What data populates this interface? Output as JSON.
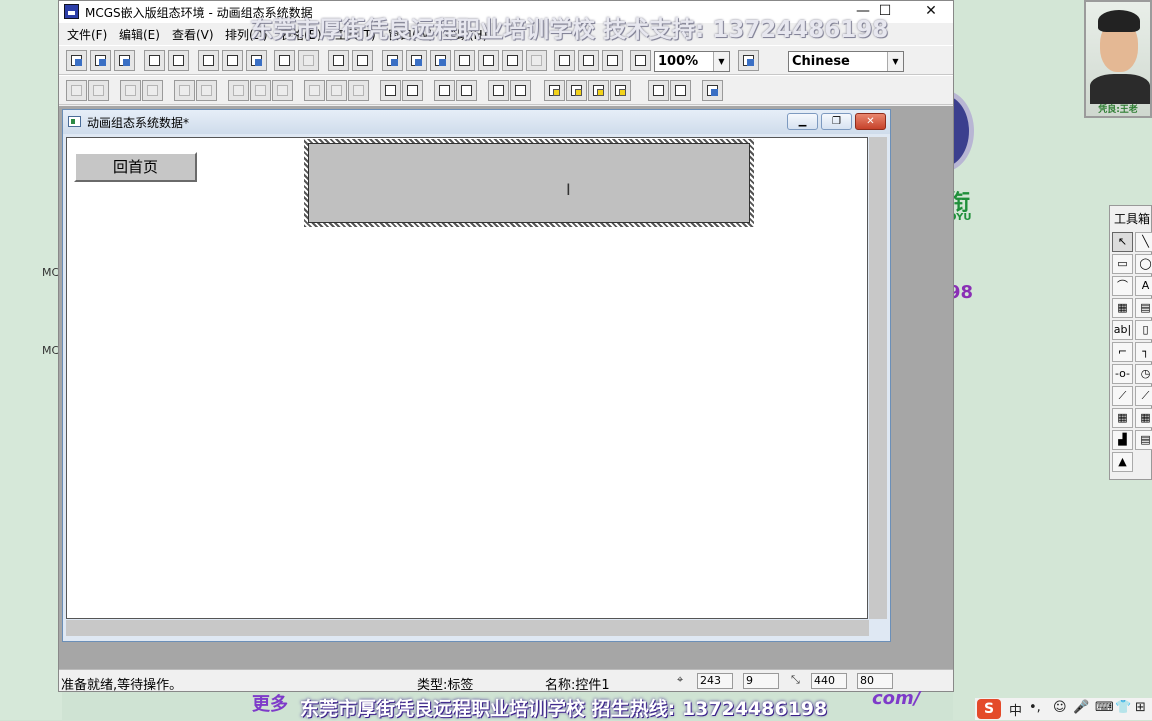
{
  "window": {
    "title": "MCGS嵌入版组态环境 - 动画组态系统数据",
    "minimize": "—",
    "maximize": "☐",
    "close": "✕"
  },
  "menu": [
    "文件(F)",
    "编辑(E)",
    "查看(V)",
    "排列(D)",
    "表格(B)",
    "工具(T)",
    "窗口(W)",
    "帮助(H)"
  ],
  "toolbar": {
    "zoom_value": "100%",
    "language_value": "Chinese"
  },
  "document": {
    "title": "动画组态系统数据*",
    "minimize": "▁",
    "restore": "❐",
    "close": "✕"
  },
  "canvas": {
    "home_button": "回首页"
  },
  "statusbar": {
    "ready": "准备就绪,等待操作。",
    "type": "类型:标签",
    "name": "名称:控件1",
    "x": "243",
    "y": "9",
    "w": "440",
    "h": "80"
  },
  "overlay": {
    "top_banner": "东莞市厚街凭良远程职业培训学校 技术支持: 13724486198",
    "bottom_banner": "东莞市厚街凭良远程职业培训学校  招生热线: 13724486198",
    "more": "更多",
    "url_tail": "com/",
    "side_char": "衔",
    "side_sub": "OYU",
    "side_digits": "98",
    "mcg_fragment": "MC"
  },
  "avatar": {
    "caption": "凭良:王老"
  },
  "toolbox": {
    "title": "工具箱",
    "tools": [
      "↖",
      "╲",
      "▭",
      "◯",
      "⌒",
      "A",
      "▦",
      "▤",
      "ab|",
      "▯",
      "⌐",
      "┐",
      "-o-",
      "◷",
      "⟋",
      "⟋",
      "▦",
      "▦",
      "▟",
      "▤",
      "▲"
    ]
  },
  "tray": {
    "ime_logo": "S",
    "ime_lang": "中",
    "punct": "•,",
    "emoji": "☺",
    "mic": "🎤",
    "keyboard": "⌨",
    "shirt": "👕",
    "grid": "⊞"
  },
  "colors": {
    "desktop": "#cfe3d3",
    "selection_fill": "#c0c0c0",
    "overlay_purple": "#7e3bc9",
    "ime_red": "#e44a2a"
  }
}
